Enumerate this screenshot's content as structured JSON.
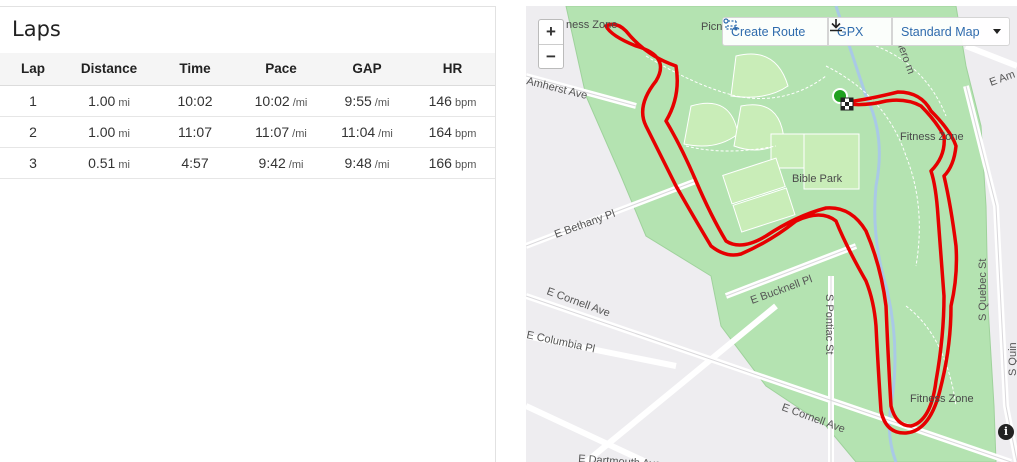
{
  "laps": {
    "title": "Laps",
    "columns": [
      "Lap",
      "Distance",
      "Time",
      "Pace",
      "GAP",
      "HR"
    ],
    "rows": [
      {
        "lap": "1",
        "distance": "1.00",
        "distance_unit": "mi",
        "time": "10:02",
        "pace": "10:02",
        "pace_unit": "/mi",
        "gap": "9:55",
        "gap_unit": "/mi",
        "hr": "146",
        "hr_unit": "bpm"
      },
      {
        "lap": "2",
        "distance": "1.00",
        "distance_unit": "mi",
        "time": "11:07",
        "pace": "11:07",
        "pace_unit": "/mi",
        "gap": "11:04",
        "gap_unit": "/mi",
        "hr": "164",
        "hr_unit": "bpm"
      },
      {
        "lap": "3",
        "distance": "0.51",
        "distance_unit": "mi",
        "time": "4:57",
        "pace": "9:42",
        "pace_unit": "/mi",
        "gap": "9:48",
        "gap_unit": "/mi",
        "hr": "166",
        "hr_unit": "bpm"
      }
    ]
  },
  "map": {
    "zoom_in": "+",
    "zoom_out": "−",
    "create_route_label": "Create Route",
    "gpx_label": "GPX",
    "map_type_label": "Standard Map",
    "info_label": "i",
    "route_color": "#e60000",
    "park_color": "#b4e3b1",
    "labels": {
      "fitness_zone_top": "ness Zone",
      "picnic": "Picn",
      "fitness_zone_mid": "Fitness Zone",
      "fitness_zone_bottom": "Fitness Zone",
      "bible_park": "Bible Park",
      "amherst": "Amherst Ave",
      "amherst_right": "E Am",
      "bethany": "E Bethany Pl",
      "cornell_left": "E Cornell Ave",
      "cornell_right": "E Cornell Ave",
      "bucknell": "E Bucknell Pl",
      "pontiac": "S Pontiac St",
      "quebec": "S Quebec St",
      "columbia": "E Columbia Pl",
      "dartmouth": "E Dartmouth Ave",
      "trail": "lero m",
      "quince": "S Quin"
    }
  }
}
